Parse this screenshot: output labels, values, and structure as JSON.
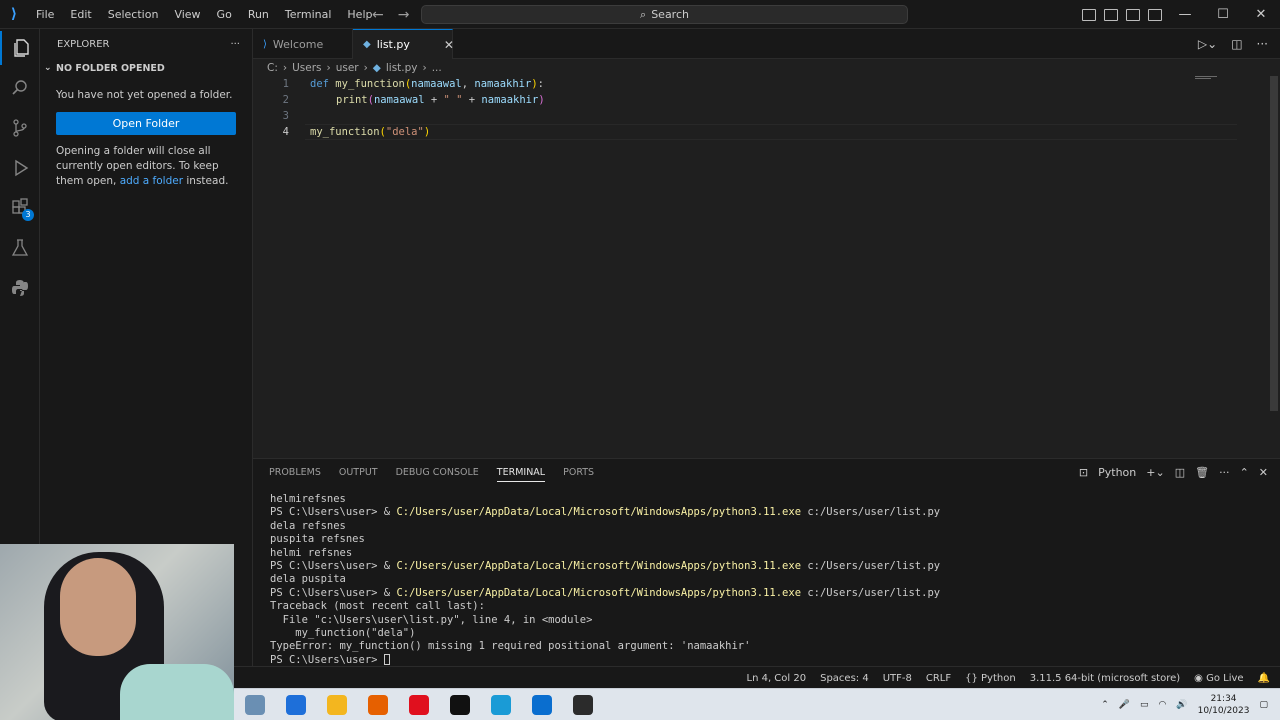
{
  "menu": [
    "File",
    "Edit",
    "Selection",
    "View",
    "Go",
    "Run",
    "Terminal",
    "Help"
  ],
  "search": {
    "label": "Search"
  },
  "window_controls": {
    "minimize": "—",
    "maximize": "☐",
    "close": "✕"
  },
  "activity_badge": "3",
  "sidebar": {
    "title": "EXPLORER",
    "more": "···",
    "section": "NO FOLDER OPENED",
    "message": "You have not yet opened a folder.",
    "button": "Open Folder",
    "info_pre": "Opening a folder will close all currently open editors. To keep them open, ",
    "info_link": "add a folder",
    "info_post": " instead."
  },
  "tabs": [
    {
      "label": "Welcome",
      "active": false
    },
    {
      "label": "list.py",
      "active": true
    }
  ],
  "breadcrumb": [
    "C:",
    "Users",
    "user",
    "list.py",
    "..."
  ],
  "code": {
    "line_numbers": [
      "1",
      "2",
      "3",
      "4"
    ],
    "l1_kw": "def",
    "l1_fn": "my_function",
    "l1_p1": "namaawal",
    "l1_sep": ", ",
    "l1_p2": "namaakhir",
    "l1_end": ":",
    "l2_fn": "print",
    "l2_p1": "namaawal",
    "l2_op": " + ",
    "l2_str": "\" \"",
    "l2_op2": " + ",
    "l2_p2": "namaakhir",
    "l4_fn": "my_function",
    "l4_str": "\"dela\""
  },
  "panel": {
    "tabs": [
      "PROBLEMS",
      "OUTPUT",
      "DEBUG CONSOLE",
      "TERMINAL",
      "PORTS"
    ],
    "active_tab": "TERMINAL",
    "shell": "Python",
    "terminal_lines": [
      {
        "text": "helmirefsnes"
      },
      {
        "prompt": "PS C:\\Users\\user> & ",
        "path": "C:/Users/user/AppData/Local/Microsoft/WindowsApps/python3.11.exe",
        "rest": " c:/Users/user/list.py"
      },
      {
        "text": "dela refsnes"
      },
      {
        "text": "puspita refsnes"
      },
      {
        "text": "helmi refsnes"
      },
      {
        "prompt": "PS C:\\Users\\user> & ",
        "path": "C:/Users/user/AppData/Local/Microsoft/WindowsApps/python3.11.exe",
        "rest": " c:/Users/user/list.py"
      },
      {
        "text": "dela puspita"
      },
      {
        "prompt": "PS C:\\Users\\user> & ",
        "path": "C:/Users/user/AppData/Local/Microsoft/WindowsApps/python3.11.exe",
        "rest": " c:/Users/user/list.py"
      },
      {
        "text": "Traceback (most recent call last):"
      },
      {
        "text": "  File \"c:\\Users\\user\\list.py\", line 4, in <module>"
      },
      {
        "text": "    my_function(\"dela\")"
      },
      {
        "text": "TypeError: my_function() missing 1 required positional argument: 'namaakhir'"
      },
      {
        "prompt": "PS C:\\Users\\user> ",
        "cursor": true
      }
    ]
  },
  "status": {
    "position": "Ln 4, Col 20",
    "spaces": "Spaces: 4",
    "encoding": "UTF-8",
    "eol": "CRLF",
    "language": "Python",
    "interpreter": "3.11.5 64-bit (microsoft store)",
    "golive": "Go Live"
  },
  "taskbar": {
    "time": "21:34",
    "date": "10/10/2023",
    "apps": [
      {
        "name": "photos",
        "color": "#6a8fb3"
      },
      {
        "name": "mail",
        "color": "#1e6fd9"
      },
      {
        "name": "file-explorer",
        "color": "#f3b61f"
      },
      {
        "name": "firefox",
        "color": "#e66000"
      },
      {
        "name": "opera",
        "color": "#e0101e"
      },
      {
        "name": "tiktok",
        "color": "#111111"
      },
      {
        "name": "edge",
        "color": "#1a9bd6"
      },
      {
        "name": "vscode",
        "color": "#0a6ecf"
      },
      {
        "name": "chrome-like",
        "color": "#2b2b2b"
      }
    ]
  },
  "colors": {
    "accent": "#0078d4",
    "keyword": "#569cd6",
    "function": "#dcdcaa",
    "string": "#ce9178",
    "param": "#9cdcfe",
    "terminal_path": "#f9f1a5"
  }
}
